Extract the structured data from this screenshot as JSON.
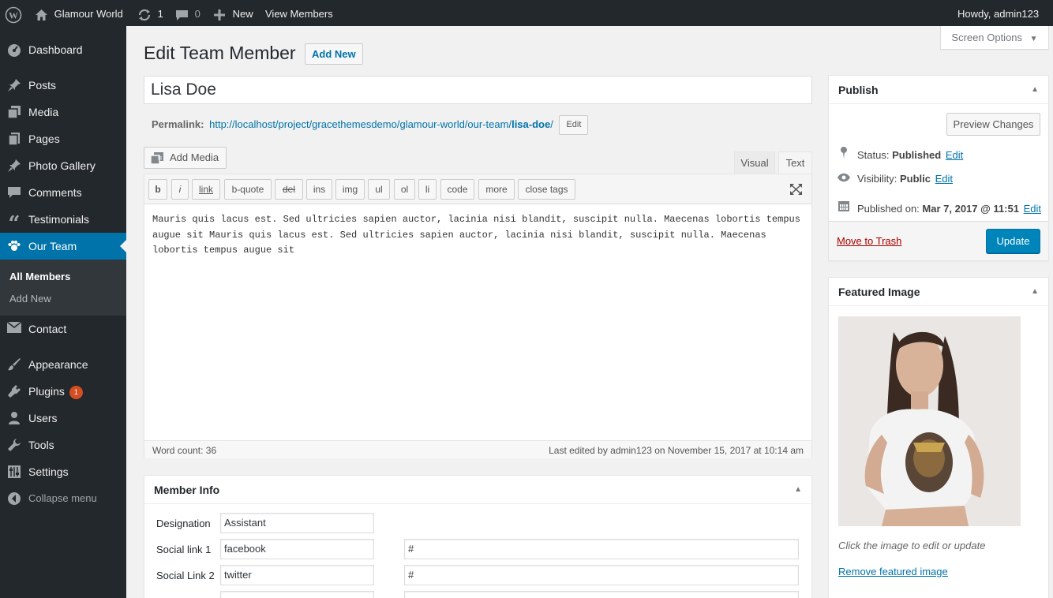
{
  "adminbar": {
    "site_name": "Glamour World",
    "updates_count": "1",
    "comments_count": "0",
    "new_label": "New",
    "view_label": "View Members",
    "howdy": "Howdy, admin123"
  },
  "sidebar": {
    "items": [
      {
        "label": "Dashboard",
        "icon": "dashboard-icon"
      },
      {
        "label": "Posts",
        "icon": "pin-icon"
      },
      {
        "label": "Media",
        "icon": "media-icon"
      },
      {
        "label": "Pages",
        "icon": "pages-icon"
      },
      {
        "label": "Photo Gallery",
        "icon": "pin-icon"
      },
      {
        "label": "Comments",
        "icon": "comment-icon"
      },
      {
        "label": "Testimonials",
        "icon": "quote-icon"
      },
      {
        "label": "Our Team",
        "icon": "team-icon"
      },
      {
        "label": "Contact",
        "icon": "mail-icon"
      },
      {
        "label": "Appearance",
        "icon": "brush-icon"
      },
      {
        "label": "Plugins",
        "icon": "plugin-icon",
        "badge": "1"
      },
      {
        "label": "Users",
        "icon": "user-icon"
      },
      {
        "label": "Tools",
        "icon": "wrench-icon"
      },
      {
        "label": "Settings",
        "icon": "settings-icon"
      },
      {
        "label": "Collapse menu",
        "icon": "collapse-icon"
      }
    ],
    "submenu": {
      "all_members": "All Members",
      "add_new": "Add New"
    }
  },
  "screen_options": "Screen Options",
  "page": {
    "title": "Edit Team Member",
    "add_new": "Add New",
    "post_title": "Lisa Doe",
    "permalink_label": "Permalink:",
    "permalink_base": "http://localhost/project/gracethemesdemo/glamour-world/our-team/",
    "permalink_slug": "lisa-doe",
    "permalink_end": "/",
    "permalink_edit": "Edit"
  },
  "editor": {
    "add_media": "Add Media",
    "tab_visual": "Visual",
    "tab_text": "Text",
    "buttons": [
      "b",
      "i",
      "link",
      "b-quote",
      "del",
      "ins",
      "img",
      "ul",
      "ol",
      "li",
      "code",
      "more",
      "close tags"
    ],
    "content": "Mauris quis lacus est. Sed ultricies sapien auctor, lacinia nisi blandit, suscipit nulla. Maecenas lobortis tempus augue sit Mauris quis lacus est. Sed ultricies sapien auctor, lacinia nisi blandit, suscipit nulla. Maecenas lobortis tempus augue sit",
    "word_count": "Word count: 36",
    "last_edited": "Last edited by admin123 on November 15, 2017 at 10:14 am"
  },
  "member_info": {
    "title": "Member Info",
    "designation_label": "Designation",
    "designation_value": "Assistant",
    "social1_label": "Social link 1",
    "social1_name": "facebook",
    "social1_url": "#",
    "social2_label": "Social Link 2",
    "social2_name": "twitter",
    "social2_url": "#"
  },
  "publish": {
    "title": "Publish",
    "preview": "Preview Changes",
    "status_label": "Status: ",
    "status_value": "Published",
    "visibility_label": "Visibility: ",
    "visibility_value": "Public",
    "published_label": "Published on: ",
    "published_value": "Mar 7, 2017 @ 11:51",
    "edit": "Edit",
    "trash": "Move to Trash",
    "update": "Update"
  },
  "featured": {
    "title": "Featured Image",
    "hint": "Click the image to edit or update",
    "remove": "Remove featured image"
  },
  "colors": {
    "accent": "#0073aa",
    "sidebar_bg": "#23282d",
    "badge": "#d54e21"
  }
}
